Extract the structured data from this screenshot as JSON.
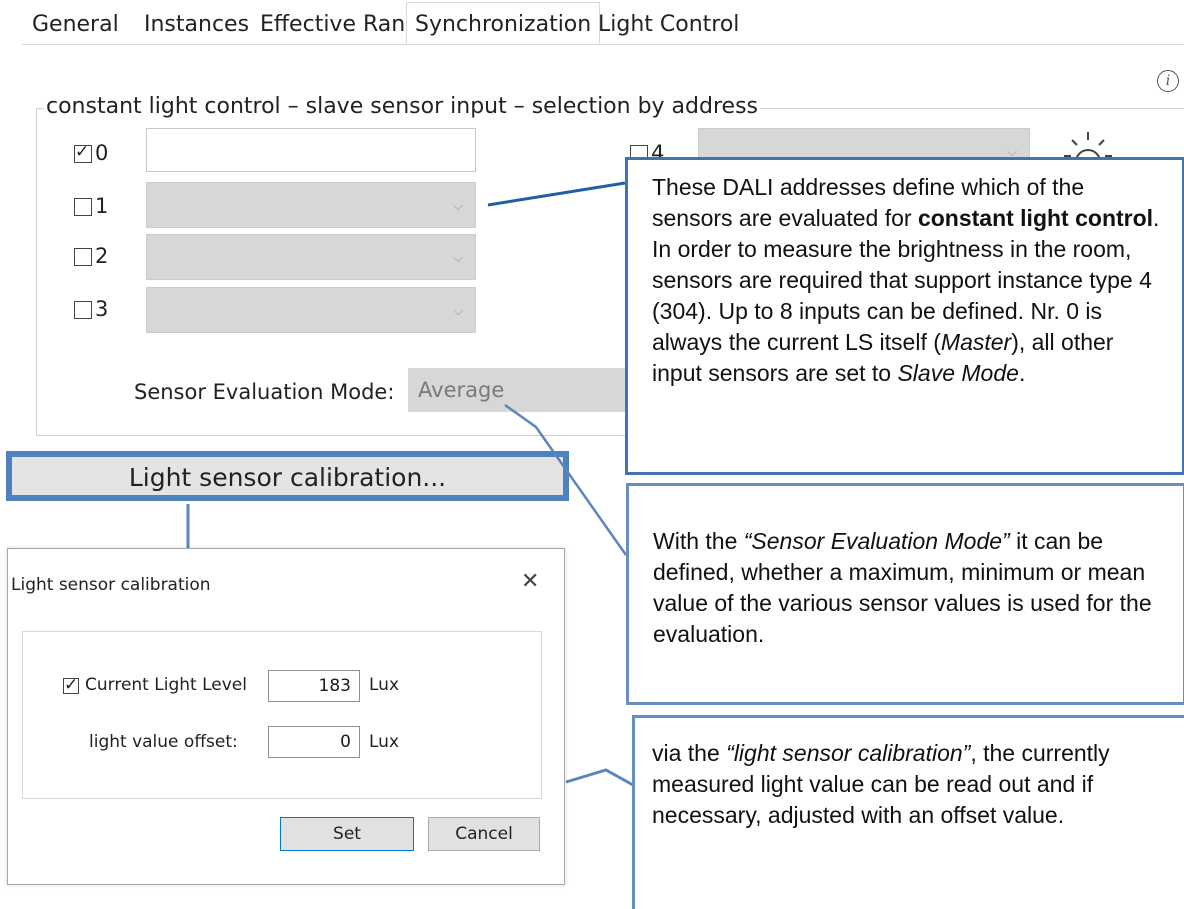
{
  "tabs": [
    {
      "label": "General"
    },
    {
      "label": "Instances"
    },
    {
      "label": "Effective Range"
    },
    {
      "label": "Synchronization"
    },
    {
      "label": "Light Control"
    }
  ],
  "group": {
    "title": "constant light control – slave sensor input – selection by address",
    "inputs": [
      {
        "number": "0",
        "checked": true
      },
      {
        "number": "1",
        "checked": false
      },
      {
        "number": "2",
        "checked": false
      },
      {
        "number": "3",
        "checked": false
      },
      {
        "number": "4",
        "checked": false
      }
    ]
  },
  "evaluation": {
    "label": "Sensor Evaluation Mode:",
    "value": "Average"
  },
  "calibration_button": {
    "label": "Light sensor calibration..."
  },
  "callouts": {
    "dali": {
      "t1": "These DALI addresses define which of the sensors are evaluated for ",
      "b1": "constant light control",
      "t2": ". In order to measure the brightness in the room, sensors are required that support instance type 4 (304). Up to 8 inputs can be defined. Nr. 0 is always the current LS itself (",
      "i1": "Master",
      "t3": "), all other input sensors are set to ",
      "i2": "Slave Mode",
      "t4": "."
    },
    "evaluation": {
      "t1": "With the ",
      "i1": "“Sensor Evaluation Mode”",
      "t2": " it can be defined, whether a maximum, minimum or mean value of the various sensor values is used for the evaluation."
    },
    "calibration": {
      "t1": "via the ",
      "i1": "“light sensor calibration”",
      "t2": ", the currently measured light value can be read out and if necessary, adjusted with an offset value."
    }
  },
  "dialog": {
    "title": "Light sensor calibration",
    "current_label": "Current Light Level",
    "current_checked": true,
    "current_value": "183",
    "offset_label": "light value offset:",
    "offset_value": "0",
    "unit": "Lux",
    "set_label": "Set",
    "cancel_label": "Cancel"
  },
  "colors": {
    "callout_border": "#3e73b4",
    "button_border": "#4d82be"
  }
}
